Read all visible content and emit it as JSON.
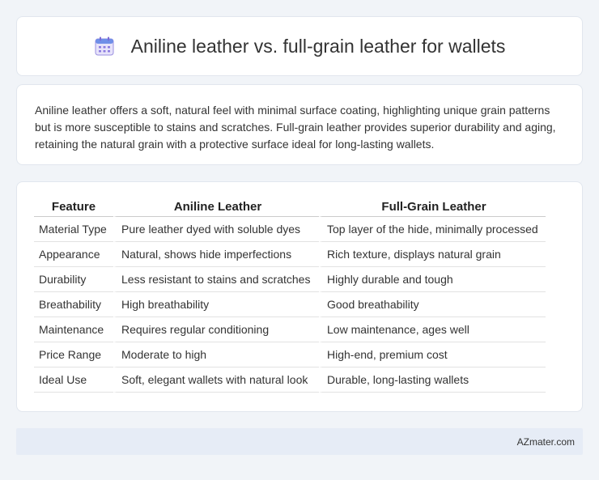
{
  "header": {
    "title": "Aniline leather vs. full-grain leather for wallets",
    "icon": "calendar-icon"
  },
  "summary": {
    "text": "Aniline leather offers a soft, natural feel with minimal surface coating, highlighting unique grain patterns but is more susceptible to stains and scratches. Full-grain leather provides superior durability and aging, retaining the natural grain with a protective surface ideal for long-lasting wallets."
  },
  "table": {
    "headers": [
      "Feature",
      "Aniline Leather",
      "Full-Grain Leather"
    ],
    "rows": [
      [
        "Material Type",
        "Pure leather dyed with soluble dyes",
        "Top layer of the hide, minimally processed"
      ],
      [
        "Appearance",
        "Natural, shows hide imperfections",
        "Rich texture, displays natural grain"
      ],
      [
        "Durability",
        "Less resistant to stains and scratches",
        "Highly durable and tough"
      ],
      [
        "Breathability",
        "High breathability",
        "Good breathability"
      ],
      [
        "Maintenance",
        "Requires regular conditioning",
        "Low maintenance, ages well"
      ],
      [
        "Price Range",
        "Moderate to high",
        "High-end, premium cost"
      ],
      [
        "Ideal Use",
        "Soft, elegant wallets with natural look",
        "Durable, long-lasting wallets"
      ]
    ]
  },
  "footer": {
    "site": "AZmater.com"
  },
  "colors": {
    "background": "#f1f4f8",
    "footer_bg": "#e6ecf6",
    "icon_accent": "#7b6ad6"
  }
}
